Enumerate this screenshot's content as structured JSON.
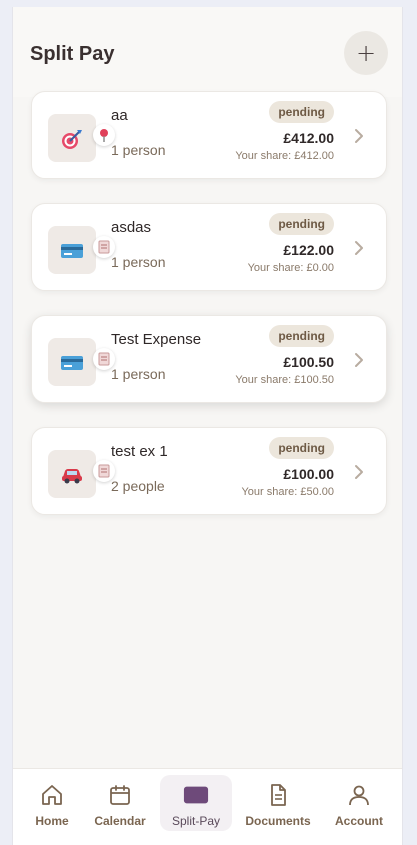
{
  "header": {
    "title": "Split Pay",
    "add_label": "+"
  },
  "expenses": [
    {
      "name": "aa",
      "people": "1 person",
      "status": "pending",
      "amount": "£412.00",
      "share": "Your share: £412.00",
      "icon": "dart-target-icon"
    },
    {
      "name": "asdas",
      "people": "1 person",
      "status": "pending",
      "amount": "£122.00",
      "share": "Your share: £0.00",
      "icon": "credit-card-icon"
    },
    {
      "name": "Test Expense",
      "people": "1 person",
      "status": "pending",
      "amount": "£100.50",
      "share": "Your share: £100.50",
      "icon": "credit-card-icon"
    },
    {
      "name": "test ex 1",
      "people": "2 people",
      "status": "pending",
      "amount": "£100.00",
      "share": "Your share: £50.00",
      "icon": "car-icon"
    }
  ],
  "nav": {
    "items": [
      {
        "label": "Home",
        "icon": "home-icon"
      },
      {
        "label": "Calendar",
        "icon": "calendar-icon"
      },
      {
        "label": "Split-Pay",
        "icon": "split-pay-icon",
        "active": true
      },
      {
        "label": "Documents",
        "icon": "document-icon"
      },
      {
        "label": "Account",
        "icon": "account-icon"
      }
    ]
  },
  "colors": {
    "accent": "#6e4a7a",
    "nav_label": "#7a6550",
    "badge_bg": "#ece6dc",
    "badge_text": "#6e5a45"
  }
}
